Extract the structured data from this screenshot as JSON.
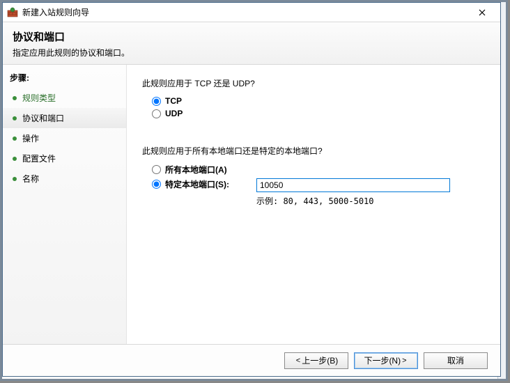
{
  "titlebar": {
    "title": "新建入站规则向导"
  },
  "header": {
    "heading": "协议和端口",
    "subheading": "指定应用此规则的协议和端口。"
  },
  "sidebar": {
    "steps_label": "步骤:",
    "items": [
      {
        "label": "规则类型",
        "link": true,
        "active": false
      },
      {
        "label": "协议和端口",
        "link": false,
        "active": true
      },
      {
        "label": "操作",
        "link": false,
        "active": false
      },
      {
        "label": "配置文件",
        "link": false,
        "active": false
      },
      {
        "label": "名称",
        "link": false,
        "active": false
      }
    ]
  },
  "content": {
    "protocol_question": "此规则应用于 TCP 还是 UDP?",
    "tcp_label": "TCP",
    "udp_label": "UDP",
    "protocol_selected": "tcp",
    "ports_question": "此规则应用于所有本地端口还是特定的本地端口?",
    "all_ports_label": "所有本地端口(A)",
    "specific_ports_label": "特定本地端口(S):",
    "ports_selected": "specific",
    "port_value": "10050",
    "example_label": "示例: 80, 443, 5000-5010"
  },
  "footer": {
    "back_label": "上一步(B)",
    "next_label": "下一步(N)",
    "cancel_label": "取消"
  }
}
